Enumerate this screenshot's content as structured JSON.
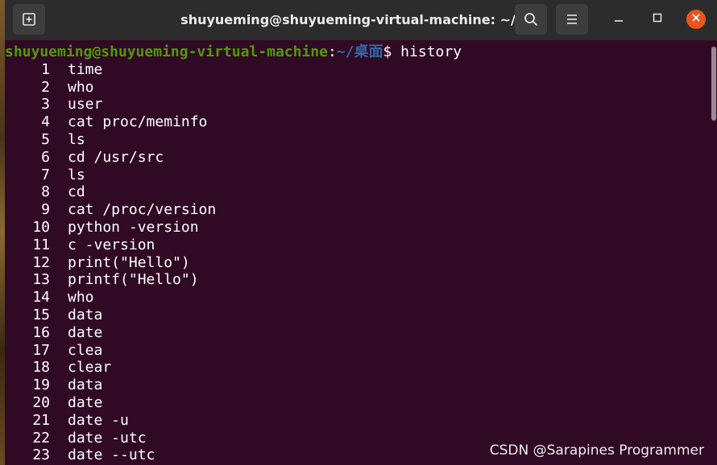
{
  "window": {
    "title": "shuyueming@shuyueming-virtual-machine: ~/桌面"
  },
  "icons": {
    "new_tab": "new-tab-icon",
    "search": "search-icon",
    "menu": "hamburger-menu-icon",
    "minimize": "minimize-icon",
    "maximize": "maximize-icon",
    "close": "close-icon"
  },
  "colors": {
    "terminal_bg": "#300a24",
    "titlebar_bg": "#2c2c2c",
    "prompt_user": "#4e9a06",
    "prompt_path": "#3465a4",
    "close_button": "#e95420"
  },
  "prompt": {
    "user_host": "shuyueming@shuyueming-virtual-machine",
    "colon": ":",
    "path": "~/桌面",
    "sign": "$",
    "command": " history"
  },
  "history": [
    {
      "num": "1",
      "cmd": "time"
    },
    {
      "num": "2",
      "cmd": "who"
    },
    {
      "num": "3",
      "cmd": "user"
    },
    {
      "num": "4",
      "cmd": "cat proc/meminfo"
    },
    {
      "num": "5",
      "cmd": "ls"
    },
    {
      "num": "6",
      "cmd": "cd /usr/src"
    },
    {
      "num": "7",
      "cmd": "ls"
    },
    {
      "num": "8",
      "cmd": "cd"
    },
    {
      "num": "9",
      "cmd": "cat /proc/version"
    },
    {
      "num": "10",
      "cmd": "python -version"
    },
    {
      "num": "11",
      "cmd": "c -version"
    },
    {
      "num": "12",
      "cmd": "print(\"Hello\")"
    },
    {
      "num": "13",
      "cmd": "printf(\"Hello\")"
    },
    {
      "num": "14",
      "cmd": "who"
    },
    {
      "num": "15",
      "cmd": "data"
    },
    {
      "num": "16",
      "cmd": "date"
    },
    {
      "num": "17",
      "cmd": "clea"
    },
    {
      "num": "18",
      "cmd": "clear"
    },
    {
      "num": "19",
      "cmd": "data"
    },
    {
      "num": "20",
      "cmd": "date"
    },
    {
      "num": "21",
      "cmd": "date -u"
    },
    {
      "num": "22",
      "cmd": "date -utc"
    },
    {
      "num": "23",
      "cmd": "date --utc"
    }
  ],
  "watermark": "CSDN @Sarapines Programmer"
}
